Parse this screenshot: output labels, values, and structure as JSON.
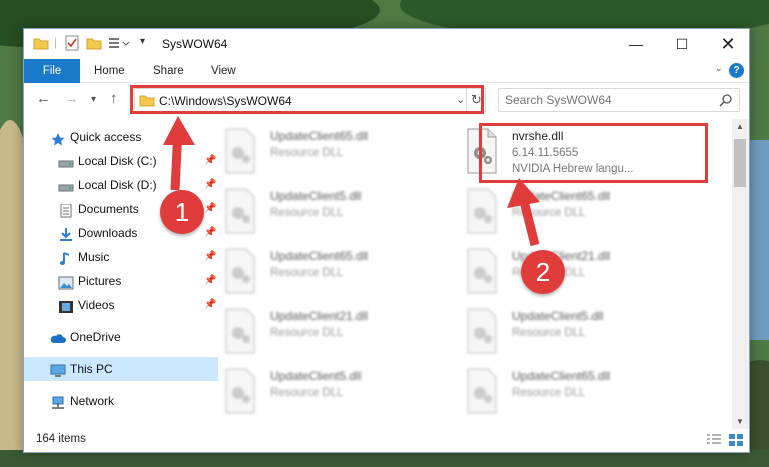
{
  "window": {
    "title": "SysWOW64"
  },
  "ribbon": {
    "tabs": [
      "File",
      "Home",
      "Share",
      "View"
    ],
    "help_label": "?"
  },
  "address": {
    "path": "C:\\Windows\\SysWOW64"
  },
  "search": {
    "placeholder": "Search SysWOW64"
  },
  "sidebar": {
    "items": [
      {
        "label": "Quick access",
        "icon": "star-icon",
        "pinned": false
      },
      {
        "label": "Local Disk (C:)",
        "icon": "drive-icon",
        "pinned": true
      },
      {
        "label": "Local Disk (D:)",
        "icon": "drive-icon",
        "pinned": true
      },
      {
        "label": "Documents",
        "icon": "documents-icon",
        "pinned": true
      },
      {
        "label": "Downloads",
        "icon": "download-icon",
        "pinned": true
      },
      {
        "label": "Music",
        "icon": "music-icon",
        "pinned": true
      },
      {
        "label": "Pictures",
        "icon": "pictures-icon",
        "pinned": true
      },
      {
        "label": "Videos",
        "icon": "videos-icon",
        "pinned": true
      },
      {
        "label": "OneDrive",
        "icon": "cloud-icon",
        "pinned": false
      },
      {
        "label": "This PC",
        "icon": "computer-icon",
        "pinned": false,
        "selected": true
      },
      {
        "label": "Network",
        "icon": "network-icon",
        "pinned": false
      }
    ]
  },
  "files": {
    "left": [
      {
        "name": "UpdateClient65.dll",
        "type": "Resource DLL"
      },
      {
        "name": "UpdateClient5.dll",
        "type": "Resource DLL"
      },
      {
        "name": "UpdateClient65.dll",
        "type": "Resource DLL"
      },
      {
        "name": "UpdateClient21.dll",
        "type": "Resource DLL"
      },
      {
        "name": "UpdateClient5.dll",
        "type": "Resource DLL"
      }
    ],
    "highlighted": {
      "name": "nvrshe.dll",
      "version": "6.14.11.5655",
      "description": "NVIDIA Hebrew langu..."
    },
    "right": [
      {
        "name": "UpdateClient65.dll",
        "type": "Resource DLL"
      },
      {
        "name": "UpdateClient21.dll",
        "type": "Resource DLL"
      },
      {
        "name": "UpdateClient5.dll",
        "type": "Resource DLL"
      },
      {
        "name": "UpdateClient65.dll",
        "type": "Resource DLL"
      }
    ]
  },
  "status": {
    "item_count": "164 items"
  },
  "annotations": {
    "callout1": "1",
    "callout2": "2",
    "color": "#e03c3c"
  }
}
